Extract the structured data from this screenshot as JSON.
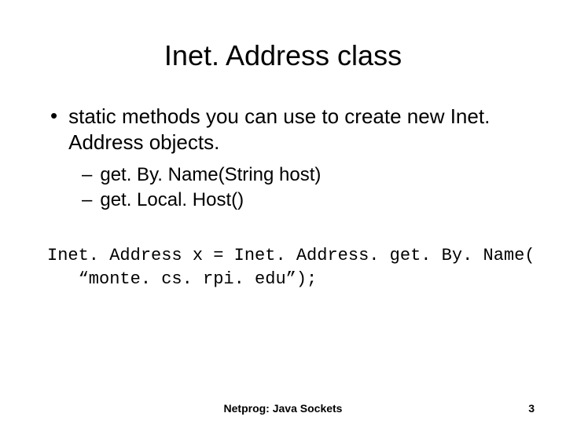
{
  "slide": {
    "title": "Inet. Address class",
    "bullet_main": "static methods you can use to create new Inet. Address objects.",
    "subs": [
      "get. By. Name(String host)",
      "get. Local. Host()"
    ],
    "code_line1": "Inet. Address x = Inet. Address. get. By. Name(",
    "code_line2": "   “monte. cs. rpi. edu”);",
    "footer_center": "Netprog: Java Sockets",
    "footer_page": "3"
  }
}
